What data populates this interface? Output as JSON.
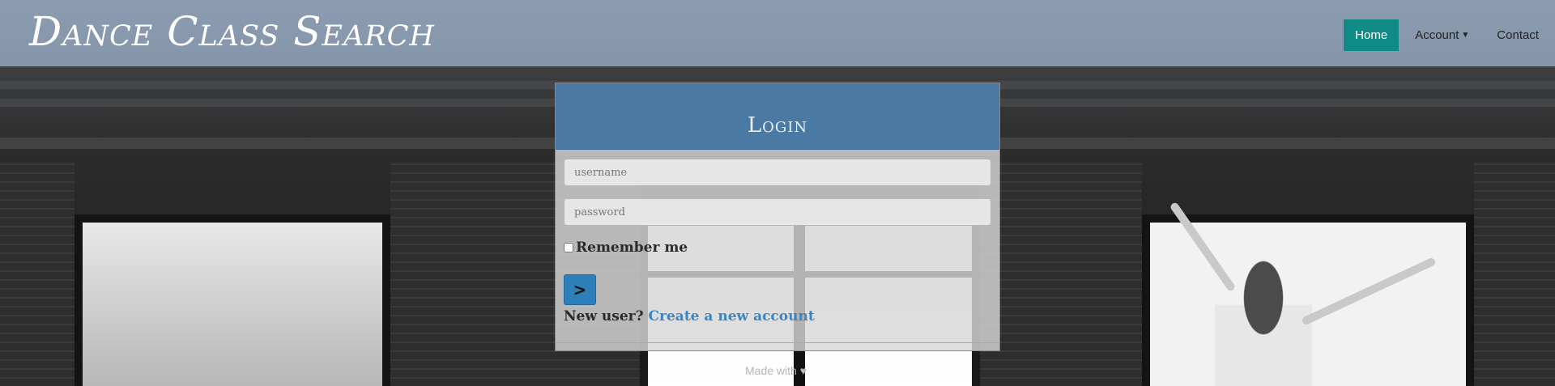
{
  "brand": {
    "title": "Dance Class Search"
  },
  "nav": {
    "items": [
      {
        "label": "Home",
        "active": true
      },
      {
        "label": "Account",
        "dropdown": true
      },
      {
        "label": "Contact"
      }
    ]
  },
  "login": {
    "title": "Login",
    "username_placeholder": "username",
    "password_placeholder": "password",
    "remember_label": "Remember me",
    "submit_icon": "chevron-right-icon",
    "new_user_label": "New user?",
    "create_account_link": "Create a new account"
  },
  "footer": {
    "made_with": "Made with",
    "heart_icon": "heart-icon"
  },
  "colors": {
    "navbar_bg": "#8fa2b8",
    "active_nav": "#0f8a85",
    "card_header": "#4a7aa3",
    "submit_button": "#2e7fb8",
    "link": "#3a86c4"
  }
}
